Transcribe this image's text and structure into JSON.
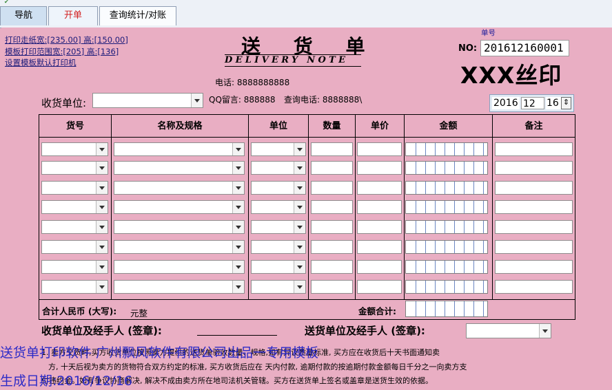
{
  "tabs": [
    {
      "label": "导航"
    },
    {
      "label": "开单"
    },
    {
      "label": "查询统计/对账"
    }
  ],
  "print_links": {
    "paper_size": "打印走纸宽:[235.00] 高:[150.00]",
    "template_range": "模板打印范围宽:[205] 高:[136]",
    "default_printer": "设置模板默认打印机"
  },
  "title": {
    "cn": "送 货 单",
    "en": "DELIVERY NOTE"
  },
  "order": {
    "caption": "单号",
    "label": "NO:",
    "number": "201612160001"
  },
  "brand": "XXX丝印",
  "contact": {
    "phone": "电话: 8888888888",
    "qq": "QQ留言: 888888",
    "query_phone": "查询电话: 8888888\\"
  },
  "receiver": {
    "label": "收货单位:",
    "value": ""
  },
  "date": {
    "year": "2016",
    "month": "12",
    "day": "16"
  },
  "table": {
    "headers": [
      "货号",
      "名称及规格",
      "单位",
      "数量",
      "单价",
      "金额",
      "备注"
    ],
    "row_count": 8
  },
  "totals": {
    "rmb_label": "合计人民币 (大写):",
    "rmb_value": "元整",
    "amount_label": "金额合计:"
  },
  "signatures": {
    "receiver": "收货单位及经手人 (签章):",
    "sender": "送货单位及经手人 (签章):"
  },
  "terms": {
    "line1": "1. 卖方交货时,买方收货单位按照卖方提供的送货单验收数量、规格,如有异议质量标准, 买方应在收货后十天书面通知卖",
    "line2": "方, 十天后视为卖方的货物符合双方约定的标准, 买方收货后应在 天内付款, 逾期付款的按逾期付款金额每日千分之一向卖方支",
    "line3": "付违约金。如有争议协商解决, 解决不成由卖方所在地司法机关管辖。买方在送货单上签名或盖章是送货生效的依据。"
  },
  "watermark": {
    "line1": "送货单打印软件 广州飘风软件有限公司出品一专用模板",
    "line2": "生成日期:2016/12/16"
  },
  "colors": {
    "background": "#e9aec3",
    "tab_active_text": "#d21e1e",
    "watermark": "#1f22c8"
  }
}
